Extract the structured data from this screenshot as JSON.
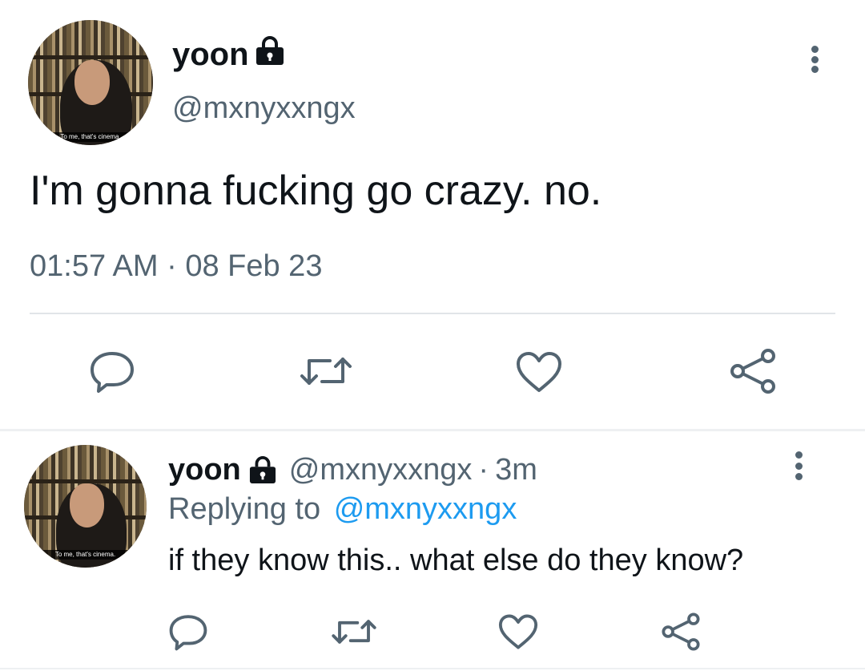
{
  "main_tweet": {
    "avatar_caption": "To me, that's cinema.",
    "display_name": "yoon",
    "handle": "@mxnyxxngx",
    "text": "I'm gonna fucking go crazy. no.",
    "timestamp": "01:57 AM · 08 Feb 23"
  },
  "reply_tweet": {
    "avatar_caption": "To me, that's cinema.",
    "display_name": "yoon",
    "handle": "@mxnyxxngx",
    "separator": "·",
    "age": "3m",
    "replying_prefix": "Replying to",
    "replying_handle": "@mxnyxxngx",
    "text": "if they know this.. what else do they know?"
  },
  "icons": [
    "lock-icon",
    "more-icon",
    "reply-icon",
    "retweet-icon",
    "like-icon",
    "share-icon"
  ],
  "colors": {
    "text": "#0f1419",
    "secondary": "#536471",
    "link": "#1d9bf0",
    "divider": "#e1e5e8"
  }
}
